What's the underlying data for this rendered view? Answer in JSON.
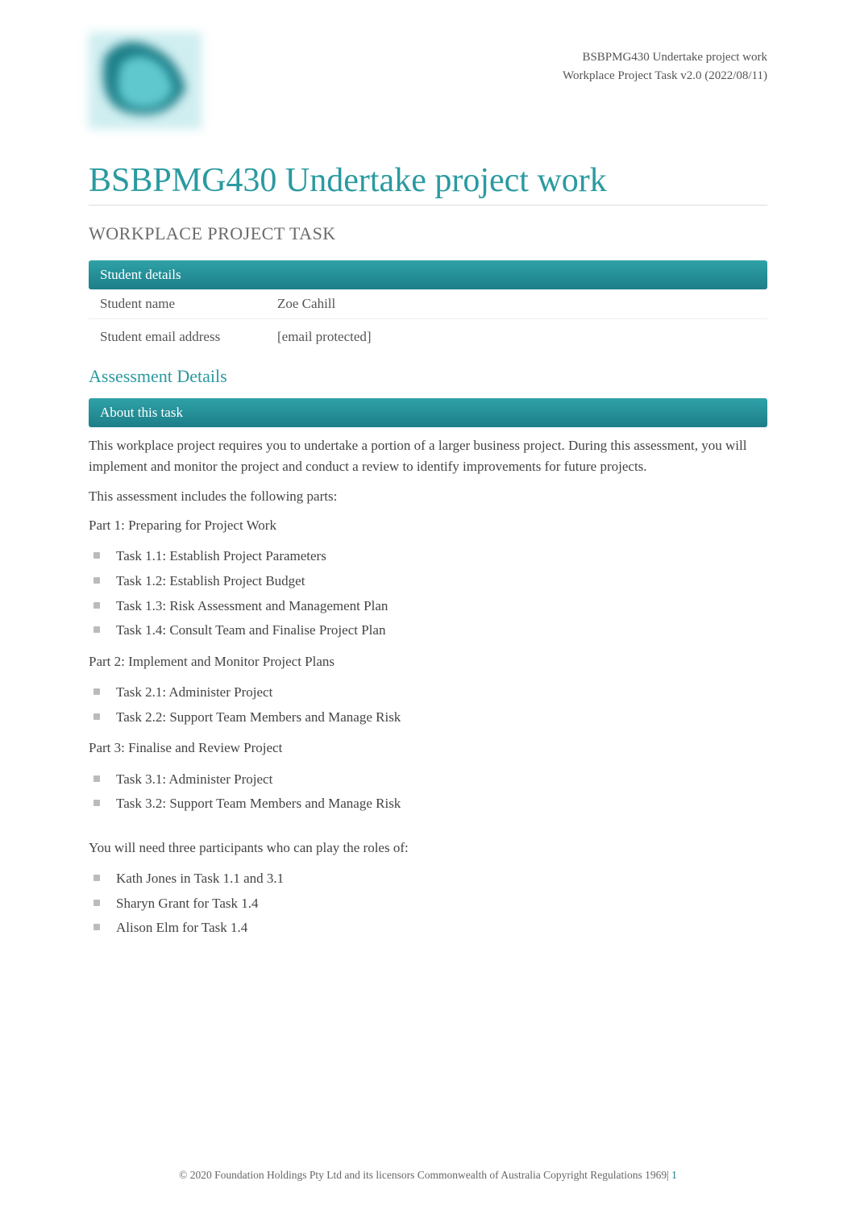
{
  "header": {
    "unit_code_line": "BSBPMG430 Undertake project work",
    "task_version_line": "Workplace Project Task v2.0 (2022/08/11)"
  },
  "title": "BSBPMG430 Undertake project work",
  "subtitle": "WORKPLACE PROJECT TASK",
  "student_details": {
    "banner": "Student details",
    "rows": [
      {
        "label": "Student name",
        "value": "Zoe Cahill"
      },
      {
        "label": "Student email address",
        "value": "[email protected]"
      }
    ]
  },
  "assessment_heading": "Assessment Details",
  "about": {
    "banner": "About this task",
    "intro": "This workplace project requires you to undertake a portion of a larger business project. During this assessment, you will implement and monitor the project and conduct a review to identify improvements for future projects.",
    "includes_line": "This assessment includes the following parts:",
    "part1_title": "Part 1: Preparing for Project Work",
    "part1_tasks": [
      "Task 1.1: Establish Project Parameters",
      "Task 1.2: Establish Project Budget",
      "Task 1.3: Risk Assessment and Management Plan",
      "Task 1.4: Consult Team and Finalise Project Plan"
    ],
    "part2_title": "Part 2: Implement and Monitor Project Plans",
    "part2_tasks": [
      "Task 2.1: Administer Project",
      "Task 2.2: Support Team Members and Manage Risk"
    ],
    "part3_title": "Part 3: Finalise and Review Project",
    "part3_tasks": [
      "Task 3.1: Administer Project",
      "Task 3.2: Support Team Members and Manage Risk"
    ],
    "participants_intro": "You will need three participants who can play the roles of:",
    "participants": [
      "Kath Jones in Task 1.1 and 3.1",
      "Sharyn Grant for Task 1.4",
      "Alison Elm for Task 1.4"
    ]
  },
  "footer": {
    "copyright": "© 2020 Foundation Holdings Pty Ltd and its licensors Commonwealth of Australia Copyright Regulations 1969",
    "page_sep": "| ",
    "page_number": "1"
  }
}
